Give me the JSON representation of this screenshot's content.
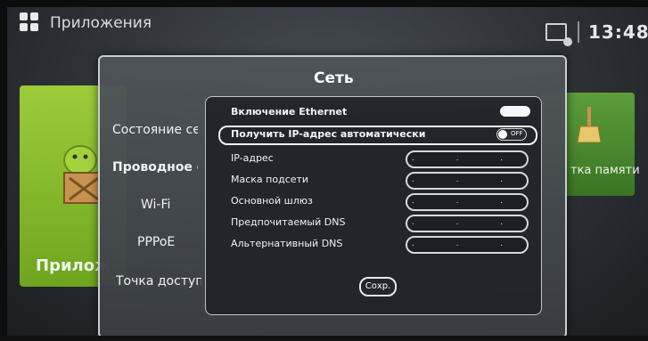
{
  "topbar": {
    "apps_title": "Приложения",
    "clock": "13:48"
  },
  "background": {
    "left_tile_label": "Прилож",
    "right_tile_label": "тка памяти"
  },
  "dialog": {
    "title": "Сеть",
    "menu": [
      {
        "label": "Состояние се",
        "active": false
      },
      {
        "label": "Проводное со",
        "active": true
      },
      {
        "label": "Wi-Fi",
        "active": false
      },
      {
        "label": "PPPoE",
        "active": false
      },
      {
        "label": "Точка доступ",
        "active": false
      }
    ],
    "settings": {
      "ethernet_label": "Включение Ethernet",
      "ethernet_enabled": true,
      "auto_ip_label": "Получить IP-адрес автоматически",
      "auto_ip_state": "OFF",
      "fields": [
        {
          "label": "IP-адрес",
          "value": ". . ."
        },
        {
          "label": "Маска подсети",
          "value": ". . ."
        },
        {
          "label": "Основной шлюз",
          "value": ". . ."
        },
        {
          "label": "Предпочитаемый DNS",
          "value": ". . ."
        },
        {
          "label": "Альтернативный DNS",
          "value": ". . ."
        }
      ],
      "save_label": "Сохр."
    }
  },
  "colors": {
    "tile_green": "#8cc034",
    "dialog_bg": "#4e545a",
    "panel_bg": "#202327"
  }
}
